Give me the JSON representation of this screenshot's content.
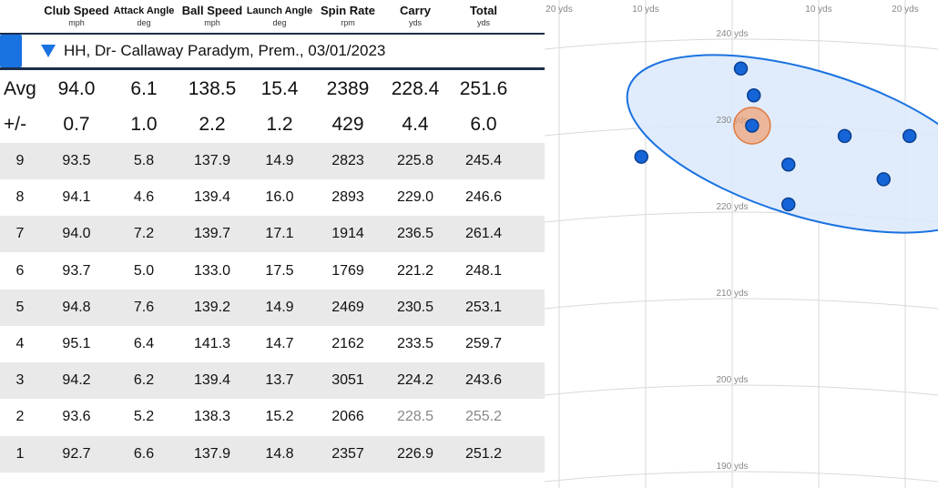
{
  "columns": [
    {
      "title": "Club Speed",
      "unit": "mph"
    },
    {
      "title": "Attack Angle",
      "unit": "deg"
    },
    {
      "title": "Ball Speed",
      "unit": "mph"
    },
    {
      "title": "Launch Angle",
      "unit": "deg"
    },
    {
      "title": "Spin Rate",
      "unit": "rpm"
    },
    {
      "title": "Carry",
      "unit": "yds"
    },
    {
      "title": "Total",
      "unit": "yds"
    }
  ],
  "session": {
    "label": "HH, Dr- Callaway Paradym, Prem., 03/01/2023"
  },
  "stats": {
    "avg_label": "Avg",
    "avg": [
      "94.0",
      "6.1",
      "138.5",
      "15.4",
      "2389",
      "228.4",
      "251.6"
    ],
    "dev_label": "+/-",
    "dev": [
      "0.7",
      "1.0",
      "2.2",
      "1.2",
      "429",
      "4.4",
      "6.0"
    ]
  },
  "shots": [
    {
      "n": "9",
      "v": [
        "93.5",
        "5.8",
        "137.9",
        "14.9",
        "2823",
        "225.8",
        "245.4"
      ]
    },
    {
      "n": "8",
      "v": [
        "94.1",
        "4.6",
        "139.4",
        "16.0",
        "2893",
        "229.0",
        "246.6"
      ]
    },
    {
      "n": "7",
      "v": [
        "94.0",
        "7.2",
        "139.7",
        "17.1",
        "1914",
        "236.5",
        "261.4"
      ]
    },
    {
      "n": "6",
      "v": [
        "93.7",
        "5.0",
        "133.0",
        "17.5",
        "1769",
        "221.2",
        "248.1"
      ]
    },
    {
      "n": "5",
      "v": [
        "94.8",
        "7.6",
        "139.2",
        "14.9",
        "2469",
        "230.5",
        "253.1"
      ]
    },
    {
      "n": "4",
      "v": [
        "95.1",
        "6.4",
        "141.3",
        "14.7",
        "2162",
        "233.5",
        "259.7"
      ]
    },
    {
      "n": "3",
      "v": [
        "94.2",
        "6.2",
        "139.4",
        "13.7",
        "3051",
        "224.2",
        "243.6"
      ]
    },
    {
      "n": "2",
      "v": [
        "93.6",
        "5.2",
        "138.3",
        "15.2",
        "2066",
        "228.5",
        "255.2"
      ],
      "excluded": true
    },
    {
      "n": "1",
      "v": [
        "92.7",
        "6.6",
        "137.9",
        "14.8",
        "2357",
        "226.9",
        "251.2"
      ]
    }
  ],
  "dispersion": {
    "x_labels": [
      {
        "text": "20 yds",
        "x": -20
      },
      {
        "text": "10 yds",
        "x": -10
      },
      {
        "text": "10 yds",
        "x": 10
      },
      {
        "text": "20 yds",
        "x": 20
      }
    ],
    "y_labels": [
      "240 yds",
      "230 yds",
      "220 yds",
      "210 yds",
      "200 yds",
      "190 yds"
    ],
    "y_values": [
      240,
      230,
      220,
      210,
      200,
      190
    ],
    "points": [
      {
        "x": 1,
        "y": 236.6
      },
      {
        "x": 2.5,
        "y": 233.5
      },
      {
        "x": 2.3,
        "y": 230.0
      },
      {
        "x": -10.5,
        "y": 226.4
      },
      {
        "x": 6.5,
        "y": 225.5
      },
      {
        "x": 13,
        "y": 228.8
      },
      {
        "x": 20.5,
        "y": 228.8
      },
      {
        "x": 17.5,
        "y": 223.8
      },
      {
        "x": 6.5,
        "y": 220.9
      }
    ],
    "average": {
      "x": 2.3,
      "y": 230.0
    },
    "colors": {
      "point": "#1565d8",
      "ellipse_fill": "#dbe9fb",
      "ellipse_stroke": "#1a72e0",
      "avg": "#f0a070",
      "avg_stroke": "#e07a40",
      "grid": "#d9d9d9"
    }
  }
}
